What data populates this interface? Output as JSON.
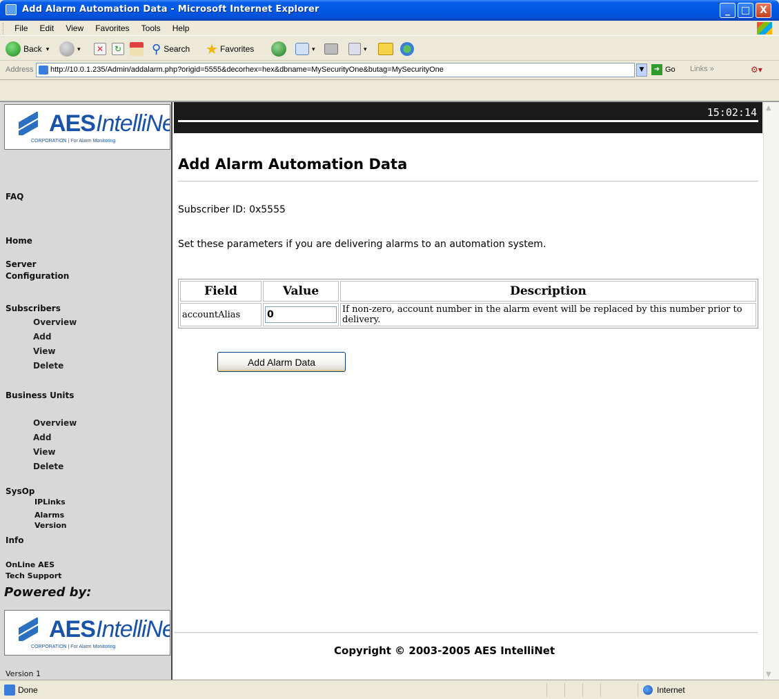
{
  "window": {
    "title": "Add Alarm Automation Data - Microsoft Internet Explorer",
    "min_label": "_",
    "max_label": "□",
    "close_label": "X"
  },
  "menu": [
    "File",
    "Edit",
    "View",
    "Favorites",
    "Tools",
    "Help"
  ],
  "toolbar": {
    "back": "Back",
    "search": "Search",
    "favorites": "Favorites"
  },
  "address": {
    "label": "Address",
    "url": "http://10.0.1.235/Admin/addalarm.php?origid=5555&decorhex=hex&dbname=MySecurityOne&butag=MySecurityOne",
    "go": "Go",
    "links": "Links"
  },
  "logo": {
    "aes": "AES",
    "intellinet": "IntelliNet",
    "corp": "CORPORATION | For Alarm Monitoring"
  },
  "clock": "15:02:14",
  "sidebar": {
    "faq": "FAQ",
    "home": "Home",
    "server": "Server",
    "configuration": "Configuration",
    "subscribers": "Subscribers",
    "subscribers_items": [
      "Overview",
      "Add",
      "View",
      "Delete"
    ],
    "business_units": "Business Units",
    "business_items": [
      "Overview",
      "Add",
      "View",
      "Delete"
    ],
    "sysop": "SysOp",
    "sysop_items": [
      "IPLinks",
      "Alarms",
      "Version"
    ],
    "info": "Info",
    "online_aes": "OnLine AES",
    "tech_support": "Tech Support",
    "powered_by": "Powered by:",
    "version": "Version 1"
  },
  "main": {
    "title": "Add Alarm Automation Data",
    "subscriber": "Subscriber ID: 0x5555",
    "intro": "Set these parameters if you are delivering alarms to an automation system.",
    "table": {
      "headers": [
        "Field",
        "Value",
        "Description"
      ],
      "rows": [
        {
          "field": "accountAlias",
          "value": "0",
          "description": "If non-zero, account number in the alarm event will be replaced by this number prior to delivery."
        }
      ]
    },
    "button": "Add Alarm Data",
    "copyright": "Copyright © 2003-2005 AES IntelliNet"
  },
  "status": {
    "text": "Done",
    "zone": "Internet"
  }
}
